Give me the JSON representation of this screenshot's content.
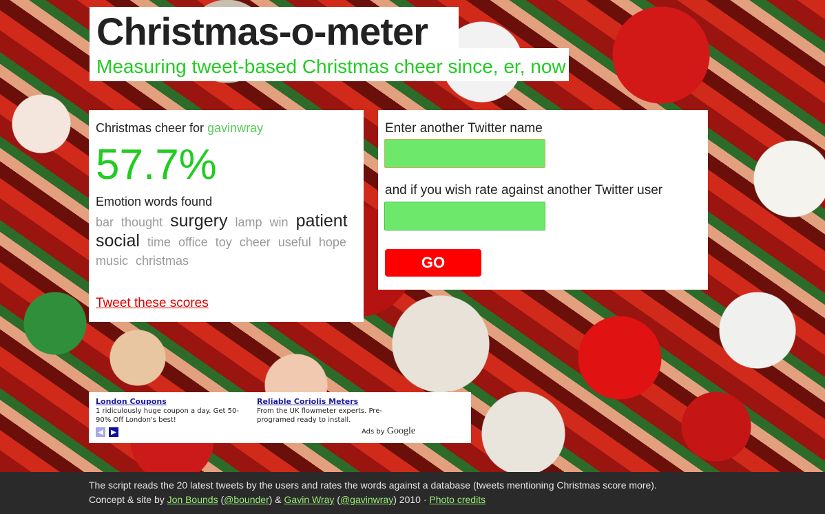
{
  "header": {
    "title": "Christmas-o-meter",
    "subtitle": "Measuring tweet-based Christmas cheer since, er, now"
  },
  "score": {
    "label": "Christmas cheer for",
    "username": "gavinwray",
    "percent": "57.7%",
    "emotion_heading": "Emotion words found",
    "words": [
      {
        "text": "bar",
        "big": false
      },
      {
        "text": "thought",
        "big": false
      },
      {
        "text": "surgery",
        "big": true
      },
      {
        "text": "lamp",
        "big": false
      },
      {
        "text": "win",
        "big": false
      },
      {
        "text": "patient",
        "big": true
      },
      {
        "text": "social",
        "big": true
      },
      {
        "text": "time",
        "big": false
      },
      {
        "text": "office",
        "big": false
      },
      {
        "text": "toy",
        "big": false
      },
      {
        "text": "cheer",
        "big": false
      },
      {
        "text": "useful",
        "big": false
      },
      {
        "text": "hope",
        "big": false
      },
      {
        "text": "music",
        "big": false
      },
      {
        "text": "christmas",
        "big": false
      }
    ],
    "tweet_link": "Tweet these scores"
  },
  "form": {
    "label1": "Enter another Twitter name",
    "input1_value": "",
    "label2": "and if you wish rate against another Twitter user",
    "input2_value": "",
    "go_label": "GO"
  },
  "ads": {
    "ad1": {
      "title": "London Coupons",
      "text": "1 ridiculously huge coupon a day. Get 50-90% Off London's best!"
    },
    "ad2": {
      "title": "Reliable Coriolis Meters",
      "text": "From the UK flowmeter experts. Pre-programed ready to install."
    },
    "ads_by": "Ads by",
    "google": "Google"
  },
  "footer": {
    "line1": "The script reads the 20 latest tweets by the users and rates the words against a database (tweets mentioning Christmas score more).",
    "concept": "Concept & site by",
    "author1": "Jon Bounds",
    "handle1": "@bounder",
    "amp": "&",
    "author2": "Gavin Wray",
    "handle2": "@gavinwray",
    "year": "2010 ·",
    "photo_credits": "Photo credits"
  },
  "colors": {
    "accent_green": "#22cc22",
    "input_green": "#6ee86a",
    "go_red": "#ff0000",
    "link_red": "#dd0000"
  }
}
